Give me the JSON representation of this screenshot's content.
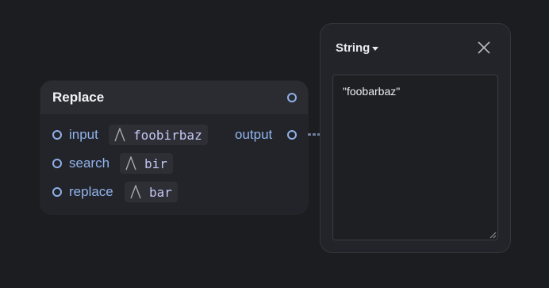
{
  "node": {
    "title": "Replace",
    "inputs": [
      {
        "label": "input",
        "value": "foobirbaz"
      },
      {
        "label": "search",
        "value": "bir"
      },
      {
        "label": "replace",
        "value": "bar"
      }
    ],
    "output_label": "output"
  },
  "panel": {
    "type_label": "String",
    "value": "\"foobarbaz\""
  },
  "icons": {
    "string_type": "string-type-icon",
    "close": "close-icon",
    "caret": "chevron-down-icon",
    "resize": "resize-handle-icon"
  },
  "colors": {
    "background": "#1b1d21",
    "node_body": "#222429",
    "node_header": "#2a2c32",
    "port": "#8fb0e8",
    "label": "#92b3ee",
    "chip_text": "#c6c8f6"
  }
}
